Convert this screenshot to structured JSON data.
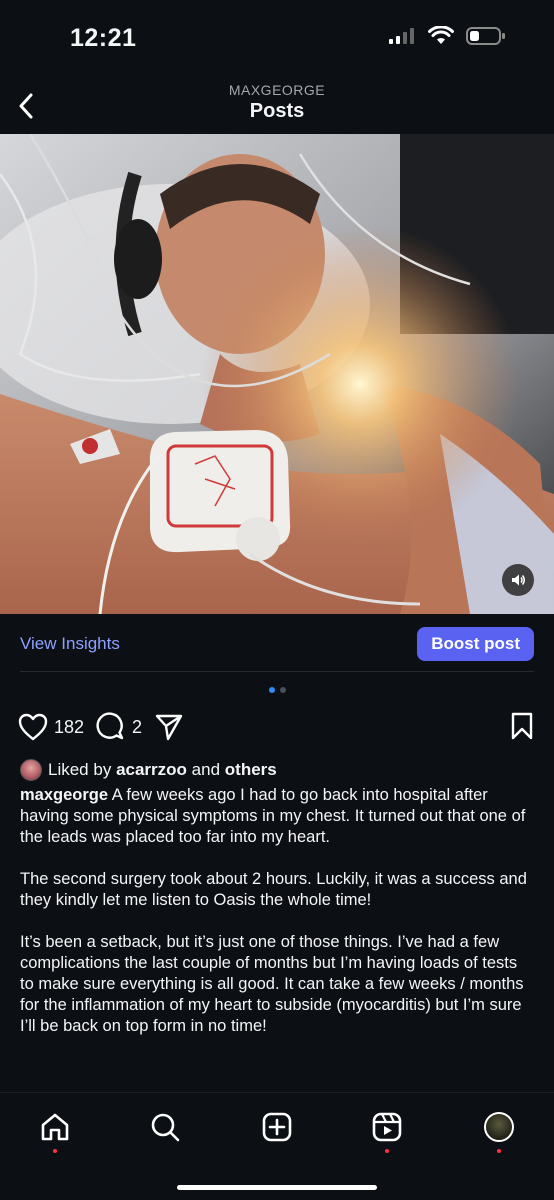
{
  "status_bar": {
    "time": "12:21"
  },
  "header": {
    "account": "MAXGEORGE",
    "title": "Posts"
  },
  "insights": {
    "view_label": "View Insights",
    "boost_label": "Boost post"
  },
  "carousel": {
    "count": 2,
    "active": 0
  },
  "actions": {
    "likes": "182",
    "comments": "2"
  },
  "liked_by": {
    "prefix": "Liked by",
    "user": "acarrzoo",
    "and": "and",
    "others": "others"
  },
  "caption": {
    "username": "maxgeorge",
    "paragraphs": [
      "A few weeks ago I had to go back into hospital after having some physical symptoms in my chest. It turned out that one of the leads was placed too far into my heart.",
      "The second surgery took about 2 hours. Luckily, it was a success and they kindly let me listen to Oasis the whole time!",
      "It’s been a setback, but it’s just one of those things. I’ve had a few complications the last couple of months but I’m having loads of tests to make sure everything is all good. It can take a few weeks / months for the inflammation of my heart to subside (myocarditis) but I’m sure I’ll be back on top form in no time!"
    ]
  },
  "nav": [
    "home-icon",
    "search-icon",
    "create-icon",
    "reels-icon",
    "profile"
  ],
  "colors": {
    "background": "#0c0f14",
    "accent": "#5a62f2",
    "link": "#8ea0ff",
    "dot_active": "#2f8cf5"
  }
}
